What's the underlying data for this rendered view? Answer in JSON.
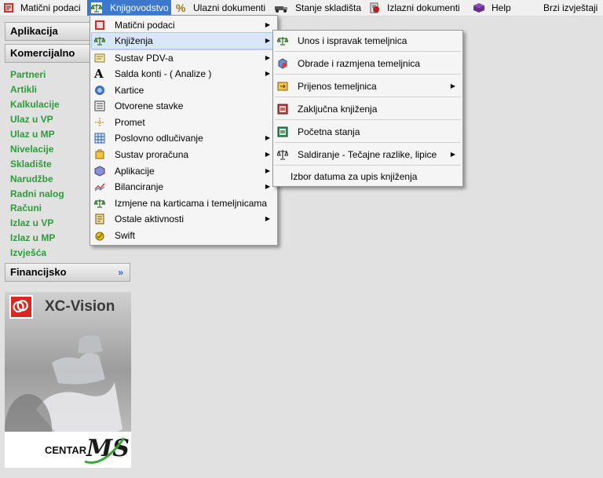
{
  "menubar": {
    "items": [
      {
        "label": "Matični podaci",
        "icon": "book-icon"
      },
      {
        "label": "Knjigovodstvo",
        "icon": "scales-icon"
      },
      {
        "label": "Ulazni dokumenti",
        "icon": "percent-icon"
      },
      {
        "label": "Stanje skladišta",
        "icon": "truck-icon"
      },
      {
        "label": "Izlazni dokumenti",
        "icon": "invoice-icon"
      },
      {
        "label": "Help",
        "icon": "help-book-icon"
      },
      {
        "label": "Brzi izvještaji",
        "icon": ""
      }
    ]
  },
  "sidebar": {
    "aplikacije": "Aplikacija",
    "komercijalno": "Komercijalno",
    "financijsko": "Financijsko",
    "links": [
      "Partneri",
      "Artikli",
      "Kalkulacije",
      "Ulaz u VP",
      "Ulaz u MP",
      "Nivelacije",
      "Skladište",
      "Narudžbe",
      "Radni nalog",
      "Računi",
      "Izlaz u VP",
      "Izlaz u MP",
      "Izvješća"
    ],
    "chevron": "»"
  },
  "promo": {
    "title": "XC-Vision",
    "brand_text": "CENTAR",
    "brand_mark": "MS"
  },
  "knjigovodstvo_menu": {
    "items": [
      {
        "label": "Matični podaci",
        "icon": "book-icon",
        "submenu": true
      },
      {
        "label": "Knjiženja",
        "icon": "scales-icon",
        "submenu": true,
        "highlighted": true
      },
      {
        "label": "Sustav PDV-a",
        "icon": "vat-icon",
        "submenu": true
      },
      {
        "label": "Salda konti - ( Analize )",
        "icon": "letter-a-icon",
        "submenu": true
      },
      {
        "label": "Kartice",
        "icon": "cards-icon",
        "submenu": false
      },
      {
        "label": "Otvorene stavke",
        "icon": "list-icon",
        "submenu": false
      },
      {
        "label": "Promet",
        "icon": "flow-icon",
        "submenu": false
      },
      {
        "label": "Poslovno odlučivanje",
        "icon": "grid-icon",
        "submenu": true
      },
      {
        "label": "Sustav proračuna",
        "icon": "budget-icon",
        "submenu": true
      },
      {
        "label": "Aplikacije",
        "icon": "apps-icon",
        "submenu": true
      },
      {
        "label": "Bilanciranje",
        "icon": "balance-chart-icon",
        "submenu": true
      },
      {
        "label": "Izmjene na karticama i temeljnicama",
        "icon": "scales-icon",
        "submenu": false
      },
      {
        "label": "Ostale aktivnosti",
        "icon": "activity-icon",
        "submenu": true
      },
      {
        "label": "Swift",
        "icon": "swift-icon",
        "submenu": false
      }
    ]
  },
  "knjizenja_submenu": {
    "items": [
      {
        "label": "Unos i ispravak temeljnica",
        "icon": "scales-icon",
        "submenu": false
      },
      {
        "label": "Obrade i razmjena temeljnica",
        "icon": "process-icon",
        "submenu": false
      },
      {
        "label": "Prijenos temeljnica",
        "icon": "transfer-icon",
        "submenu": true
      },
      {
        "label": "Zaključna knjiženja",
        "icon": "closing-icon",
        "submenu": false
      },
      {
        "label": "Početna stanja",
        "icon": "opening-icon",
        "submenu": false
      },
      {
        "label": "Saldiranje - Tečajne razlike, lipice",
        "icon": "balance-icon",
        "submenu": true
      },
      {
        "label": "Izbor datuma za upis knjiženja",
        "icon": "",
        "submenu": false
      }
    ]
  }
}
